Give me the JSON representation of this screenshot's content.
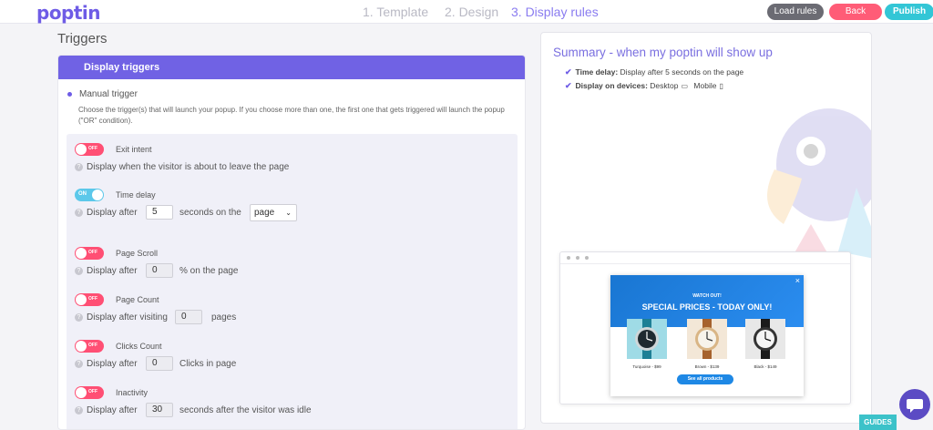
{
  "header": {
    "logo": "poptin",
    "steps": [
      "1. Template",
      "2. Design",
      "3. Display rules"
    ],
    "active_step": 2,
    "buttons": {
      "load_rules": "Load rules",
      "back": "Back",
      "publish": "Publish"
    },
    "colors": {
      "brand": "#6e5ce6",
      "back": "#ff5c77",
      "publish": "#33c6d6",
      "load": "#6b6b73"
    }
  },
  "triggers": {
    "title": "Triggers",
    "panel_title": "Display triggers",
    "mode_label": "Manual trigger",
    "description": "Choose the trigger(s) that will launch your popup. If you choose more than one, the first one that gets triggered will launch the popup (\"OR\" condition).",
    "toggle_off": "OFF",
    "toggle_on": "ON",
    "items": [
      {
        "name": "Exit intent",
        "state": "OFF",
        "desc": "Display when the visitor is about to leave the page"
      },
      {
        "name": "Time delay",
        "state": "ON",
        "desc_pre": "Display after",
        "value": "5",
        "desc_mid": "seconds on the",
        "select": "page"
      },
      {
        "name": "Page Scroll",
        "state": "OFF",
        "desc_pre": "Display after",
        "value": "0",
        "desc_post": "% on the page"
      },
      {
        "name": "Page Count",
        "state": "OFF",
        "desc_pre": "Display after visiting",
        "value": "0",
        "desc_post": "pages"
      },
      {
        "name": "Clicks Count",
        "state": "OFF",
        "desc_pre": "Display after",
        "value": "0",
        "desc_post": "Clicks in page"
      },
      {
        "name": "Inactivity",
        "state": "OFF",
        "desc_pre": "Display after",
        "value": "30",
        "desc_post": "seconds after the visitor was idle"
      }
    ]
  },
  "summary": {
    "title": "Summary - when my poptin will show up",
    "time_delay_label": "Time delay:",
    "time_delay_text": "Display after 5 seconds on the page",
    "devices_label": "Display on devices:",
    "device_desktop": "Desktop",
    "device_mobile": "Mobile"
  },
  "preview": {
    "close": "×",
    "watch_out": "WATCH OUT!",
    "headline": "SPECIAL PRICES - TODAY ONLY!",
    "products": [
      {
        "label": "Turquoise - $99"
      },
      {
        "label": "Brown - $139"
      },
      {
        "label": "Black - $149"
      }
    ],
    "cta": "See all products"
  },
  "footer": {
    "guides": "GUIDES"
  }
}
